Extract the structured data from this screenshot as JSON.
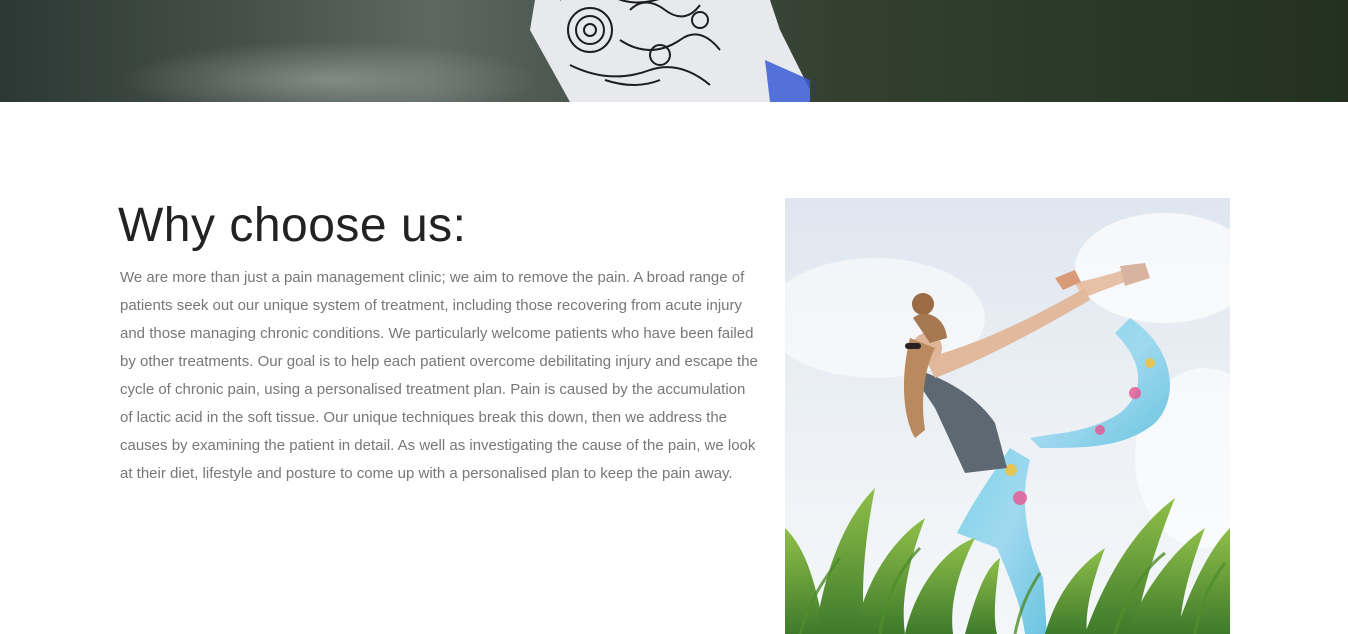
{
  "section": {
    "heading": "Why choose us:",
    "paragraph": "We are more than just a pain management clinic; we aim to remove the pain. A broad range of patients seek out our unique system of treatment, including those recovering from acute injury and those managing chronic conditions. We particularly welcome patients who have been failed by other treatments. Our goal is to help each patient overcome debilitating injury and escape the cycle of chronic pain, using a personalised treatment plan. Pain is caused by the accumulation of lactic acid in the soft tissue. Our unique techniques break this down, then we address the causes by examining the patient in detail. As well as investigating the cause of the pain, we look at their diet, lifestyle and posture to come up with a personalised plan to keep the pain away."
  },
  "images": {
    "hero_banner": "tattooed-arm-banner-image",
    "yoga_photo": "woman-yoga-pose-in-grass-photo"
  },
  "colors": {
    "heading": "#222222",
    "body_text": "#777777",
    "background": "#ffffff"
  }
}
